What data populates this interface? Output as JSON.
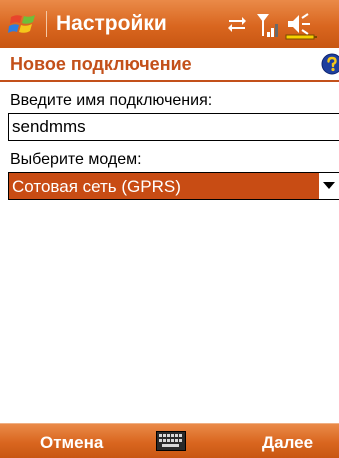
{
  "titlebar": {
    "title": "Настройки",
    "icons": [
      "windows-start-icon",
      "connectivity-icon",
      "signal-strength-icon",
      "volume-icon"
    ]
  },
  "page": {
    "title": "Новое подключение",
    "help_icon": "help-icon"
  },
  "form": {
    "name_label": "Введите имя подключения:",
    "name_value": "sendmms",
    "modem_label": "Выберите модем:",
    "modem_value": "Сотовая сеть (GPRS)"
  },
  "menubar": {
    "left_softkey": "Отмена",
    "center_icon": "keyboard-icon",
    "right_softkey": "Далее"
  },
  "colors": {
    "bar_orange": "#d9661f",
    "accent": "#c3501a",
    "selection": "#c84c14"
  }
}
